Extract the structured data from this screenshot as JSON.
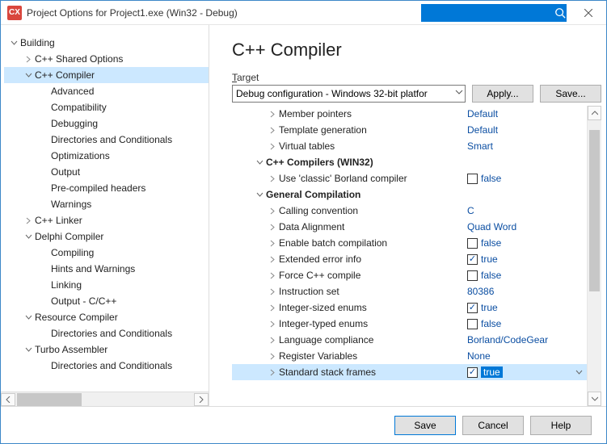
{
  "window": {
    "title": "Project Options for Project1.exe (Win32 - Debug)"
  },
  "sidebar": {
    "items": [
      {
        "label": "Building",
        "exp": "down",
        "level": 0
      },
      {
        "label": "C++ Shared Options",
        "exp": "right",
        "level": 1
      },
      {
        "label": "C++ Compiler",
        "exp": "down",
        "level": 1,
        "selected": true
      },
      {
        "label": "Advanced",
        "level": 2
      },
      {
        "label": "Compatibility",
        "level": 2
      },
      {
        "label": "Debugging",
        "level": 2
      },
      {
        "label": "Directories and Conditionals",
        "level": 2
      },
      {
        "label": "Optimizations",
        "level": 2
      },
      {
        "label": "Output",
        "level": 2
      },
      {
        "label": "Pre-compiled headers",
        "level": 2
      },
      {
        "label": "Warnings",
        "level": 2
      },
      {
        "label": "C++ Linker",
        "exp": "right",
        "level": 1
      },
      {
        "label": "Delphi Compiler",
        "exp": "down",
        "level": 1
      },
      {
        "label": "Compiling",
        "level": 2
      },
      {
        "label": "Hints and Warnings",
        "level": 2
      },
      {
        "label": "Linking",
        "level": 2
      },
      {
        "label": "Output - C/C++",
        "level": 2
      },
      {
        "label": "Resource Compiler",
        "exp": "down",
        "level": 1
      },
      {
        "label": "Directories and Conditionals",
        "level": 2
      },
      {
        "label": "Turbo Assembler",
        "exp": "down",
        "level": 1
      },
      {
        "label": "Directories and Conditionals",
        "level": 2
      }
    ]
  },
  "main": {
    "heading": "C++ Compiler",
    "target_label": "Target",
    "target_value": "Debug configuration - Windows 32-bit platfor",
    "apply_label": "Apply...",
    "save_label": "Save..."
  },
  "options": [
    {
      "name": "Member pointers",
      "value": "Default",
      "level": 1,
      "exp": "right",
      "type": "text"
    },
    {
      "name": "Template generation",
      "value": "Default",
      "level": 1,
      "exp": "right",
      "type": "text"
    },
    {
      "name": "Virtual tables",
      "value": "Smart",
      "level": 1,
      "exp": "right",
      "type": "text"
    },
    {
      "name": "C++ Compilers (WIN32)",
      "level": 0,
      "exp": "down",
      "type": "group"
    },
    {
      "name": "Use 'classic' Borland compiler",
      "value": "false",
      "level": 1,
      "exp": "right",
      "type": "check",
      "checked": false
    },
    {
      "name": "General Compilation",
      "level": 0,
      "exp": "down",
      "type": "group"
    },
    {
      "name": "Calling convention",
      "value": "C",
      "level": 1,
      "exp": "right",
      "type": "text"
    },
    {
      "name": "Data Alignment",
      "value": "Quad Word",
      "level": 1,
      "exp": "right",
      "type": "text"
    },
    {
      "name": "Enable batch compilation",
      "value": "false",
      "level": 1,
      "exp": "right",
      "type": "check",
      "checked": false
    },
    {
      "name": "Extended error info",
      "value": "true",
      "level": 1,
      "exp": "right",
      "type": "check",
      "checked": true
    },
    {
      "name": "Force C++ compile",
      "value": "false",
      "level": 1,
      "exp": "right",
      "type": "check",
      "checked": false
    },
    {
      "name": "Instruction set",
      "value": "80386",
      "level": 1,
      "exp": "right",
      "type": "text"
    },
    {
      "name": "Integer-sized enums",
      "value": "true",
      "level": 1,
      "exp": "right",
      "type": "check",
      "checked": true
    },
    {
      "name": "Integer-typed enums",
      "value": "false",
      "level": 1,
      "exp": "right",
      "type": "check",
      "checked": false
    },
    {
      "name": "Language compliance",
      "value": "Borland/CodeGear",
      "level": 1,
      "exp": "right",
      "type": "text"
    },
    {
      "name": "Register Variables",
      "value": "None",
      "level": 1,
      "exp": "right",
      "type": "text"
    },
    {
      "name": "Standard stack frames",
      "value": "true",
      "level": 1,
      "exp": "right",
      "type": "edit",
      "checked": true,
      "selected": true
    }
  ],
  "footer": {
    "save": "Save",
    "cancel": "Cancel",
    "help": "Help"
  }
}
